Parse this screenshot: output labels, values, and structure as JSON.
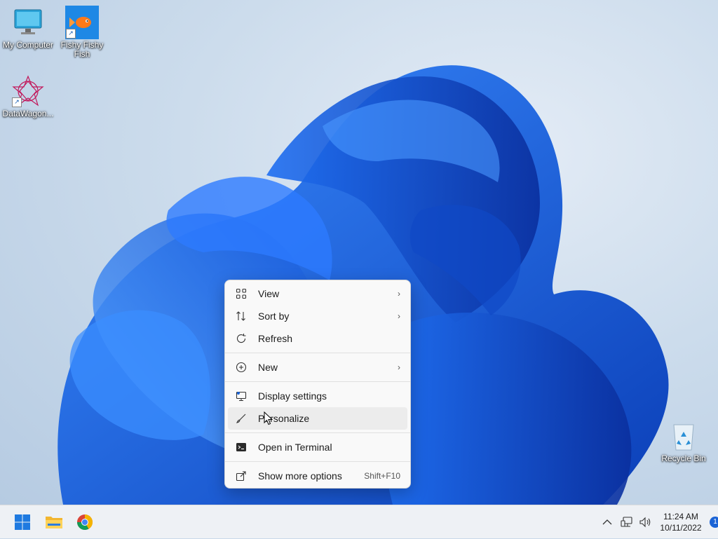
{
  "desktop": {
    "icons": [
      {
        "label": "My Computer"
      },
      {
        "label": "Fishy Fishy Fish"
      },
      {
        "label": "DataWagon..."
      },
      {
        "label": "Recycle Bin"
      }
    ]
  },
  "context_menu": {
    "items": [
      {
        "label": "View",
        "icon": "grid-icon",
        "submenu": true
      },
      {
        "label": "Sort by",
        "icon": "sort-icon",
        "submenu": true
      },
      {
        "label": "Refresh",
        "icon": "refresh-icon"
      },
      {
        "label": "New",
        "icon": "plus-circle-icon",
        "submenu": true
      },
      {
        "label": "Display settings",
        "icon": "display-icon"
      },
      {
        "label": "Personalize",
        "icon": "brush-icon",
        "hovered": true
      },
      {
        "label": "Open in Terminal",
        "icon": "terminal-icon"
      },
      {
        "label": "Show more options",
        "icon": "share-icon",
        "shortcut": "Shift+F10"
      }
    ]
  },
  "taskbar": {
    "apps": [
      {
        "name": "start-button"
      },
      {
        "name": "file-explorer"
      },
      {
        "name": "chrome"
      }
    ],
    "clock": {
      "time": "11:24 AM",
      "date": "10/11/2022"
    },
    "notification_count": "1"
  },
  "colors": {
    "accent": "#1a63d6",
    "menu_bg": "#f9f9f9",
    "taskbar_bg": "#eef1f5"
  }
}
